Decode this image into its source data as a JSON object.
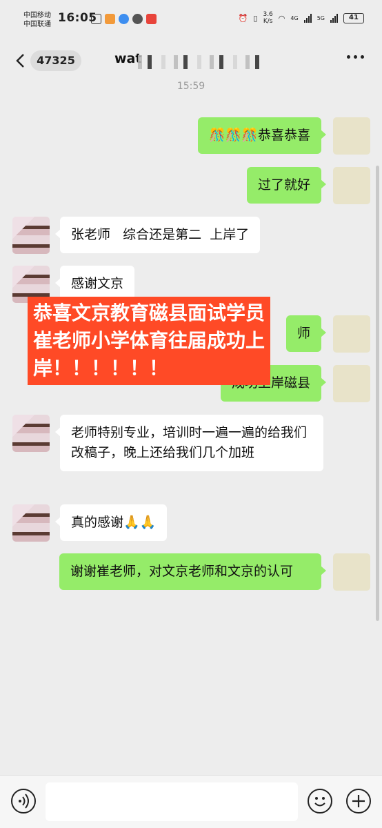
{
  "status_bar": {
    "carrier_1": "中国移动",
    "carrier_2": "中国联通",
    "time": "16:05",
    "net_speed_value": "3.6",
    "net_speed_unit": "K/s",
    "net_type_1": "4G",
    "net_type_2": "5G",
    "battery": "41"
  },
  "header": {
    "unread_count": "47325",
    "title": "wat"
  },
  "timestamp": "15:59",
  "messages": [
    {
      "side": "me",
      "emoji": "🎊🎊🎊",
      "text": "恭喜恭喜"
    },
    {
      "side": "me",
      "text": "过了就好"
    },
    {
      "side": "other",
      "text": "张老师   综合还是第二  上岸了"
    },
    {
      "side": "other",
      "text": "感谢文京"
    },
    {
      "side": "me",
      "text": "师"
    },
    {
      "side": "me",
      "text": "成功上岸磁县"
    },
    {
      "side": "other",
      "text": "老师特别专业，培训时一遍一遍的给我们改稿子，晚上还给我们几个加班"
    },
    {
      "side": "other",
      "text": "真的感谢",
      "emoji": "🙏🙏"
    },
    {
      "side": "me",
      "text": "谢谢崔老师，对文京老师和文京的认可"
    }
  ],
  "overlay": {
    "line1": "恭喜文京教育磁县面试学员",
    "line2": "崔老师小学体育往届成功上",
    "line3": "岸！！！！！！"
  },
  "input_bar": {
    "placeholder": ""
  }
}
